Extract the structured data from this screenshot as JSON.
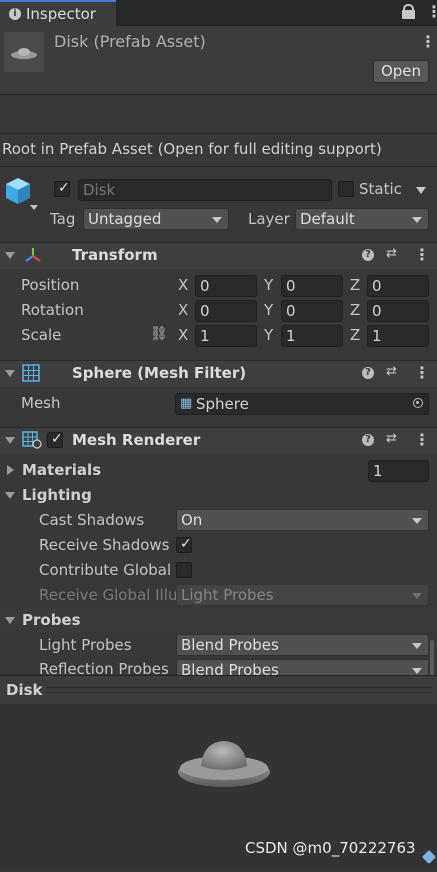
{
  "tab": {
    "title": "Inspector"
  },
  "asset": {
    "name": "Disk (Prefab Asset)",
    "open_label": "Open"
  },
  "notice": "Root in Prefab Asset (Open for full editing support)",
  "gameobject": {
    "name_placeholder": "Disk",
    "static_label": "Static",
    "tag_label": "Tag",
    "tag_value": "Untagged",
    "layer_label": "Layer",
    "layer_value": "Default"
  },
  "transform": {
    "title": "Transform",
    "position": {
      "label": "Position",
      "x": "0",
      "y": "0",
      "z": "0"
    },
    "rotation": {
      "label": "Rotation",
      "x": "0",
      "y": "0",
      "z": "0"
    },
    "scale": {
      "label": "Scale",
      "x": "1",
      "y": "1",
      "z": "1"
    },
    "axis_x": "X",
    "axis_y": "Y",
    "axis_z": "Z"
  },
  "mesh_filter": {
    "title": "Sphere (Mesh Filter)",
    "mesh_label": "Mesh",
    "mesh_value": "Sphere"
  },
  "mesh_renderer": {
    "title": "Mesh Renderer",
    "materials_label": "Materials",
    "materials_count": "1",
    "lighting_label": "Lighting",
    "cast_shadows_label": "Cast Shadows",
    "cast_shadows_value": "On",
    "receive_shadows_label": "Receive Shadows",
    "contribute_gi_label": "Contribute Global I",
    "receive_gi_label": "Receive Global Illu",
    "receive_gi_value": "Light Probes",
    "probes_label": "Probes",
    "light_probes_label": "Light Probes",
    "light_probes_value": "Blend Probes",
    "reflection_probes_label": "Reflection Probes",
    "reflection_probes_value": "Blend Probes"
  },
  "preview": {
    "title": "Disk"
  },
  "watermark": "CSDN @m0_70222763",
  "colors": {
    "panel": "#383838",
    "header": "#3e3e3e",
    "field": "#2a2a2a",
    "preview_bg": "#333333"
  }
}
